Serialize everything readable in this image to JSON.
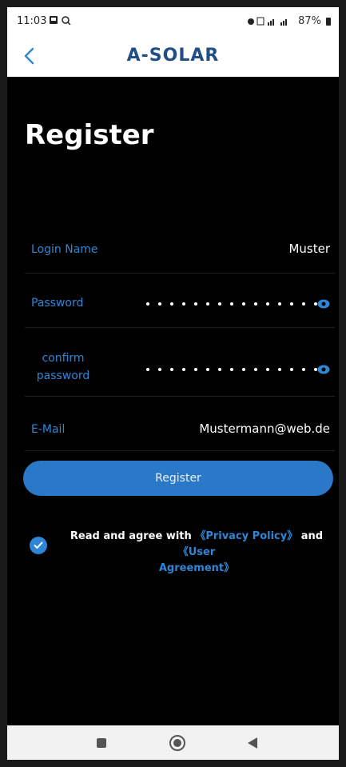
{
  "status_bar": {
    "time": "11:03",
    "battery": "87%"
  },
  "header": {
    "brand": "A-SOLAR"
  },
  "page": {
    "title": "Register"
  },
  "form": {
    "login_name": {
      "label": "Login Name",
      "value": "Muster"
    },
    "password": {
      "label": "Password",
      "masked_length": 15
    },
    "confirm_password": {
      "label_line1": "confirm",
      "label_line2": "password",
      "masked_length": 15
    },
    "email": {
      "label": "E-Mail",
      "value": "Mustermann@web.de"
    }
  },
  "register_button": {
    "label": "Register"
  },
  "agreement": {
    "prefix": "Read and agree with",
    "privacy_policy": "《Privacy Policy》",
    "and": "and",
    "user_agreement_line1": "《User",
    "user_agreement_line2": "Agreement》",
    "checked": true
  },
  "colors": {
    "brand": "#1f4f86",
    "accent": "#2f86d6",
    "button": "#2a78c8",
    "background": "#000000"
  }
}
